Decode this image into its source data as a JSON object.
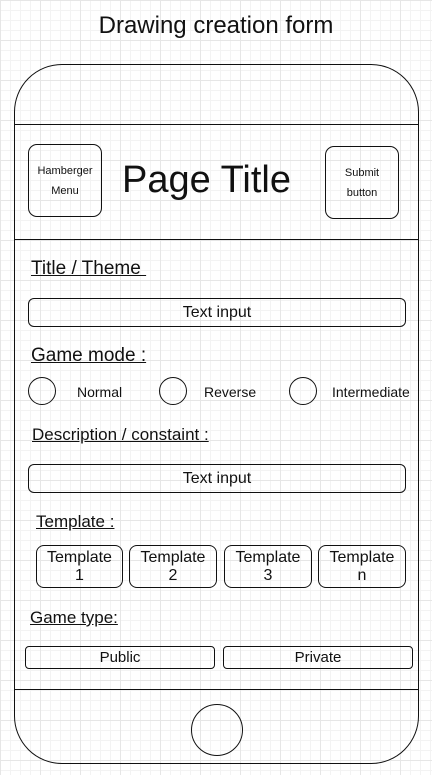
{
  "heading": "Drawing creation form",
  "header": {
    "menu_label": "Hamberger\nMenu",
    "title": "Page Title",
    "submit_label": "Submit\nbutton"
  },
  "form": {
    "title_label": "Title / Theme ",
    "title_input": "Text input",
    "game_mode_label": "Game mode :",
    "modes": [
      "Normal",
      "Reverse",
      "Intermediate"
    ],
    "description_label": "Description / constaint :",
    "description_input": "Text input",
    "template_label": "Template :",
    "templates": [
      "Template\n1",
      "Template\n2",
      "Template\n3",
      "Template\nn"
    ],
    "game_type_label": "Game type:",
    "game_types": [
      "Public",
      "Private"
    ]
  }
}
